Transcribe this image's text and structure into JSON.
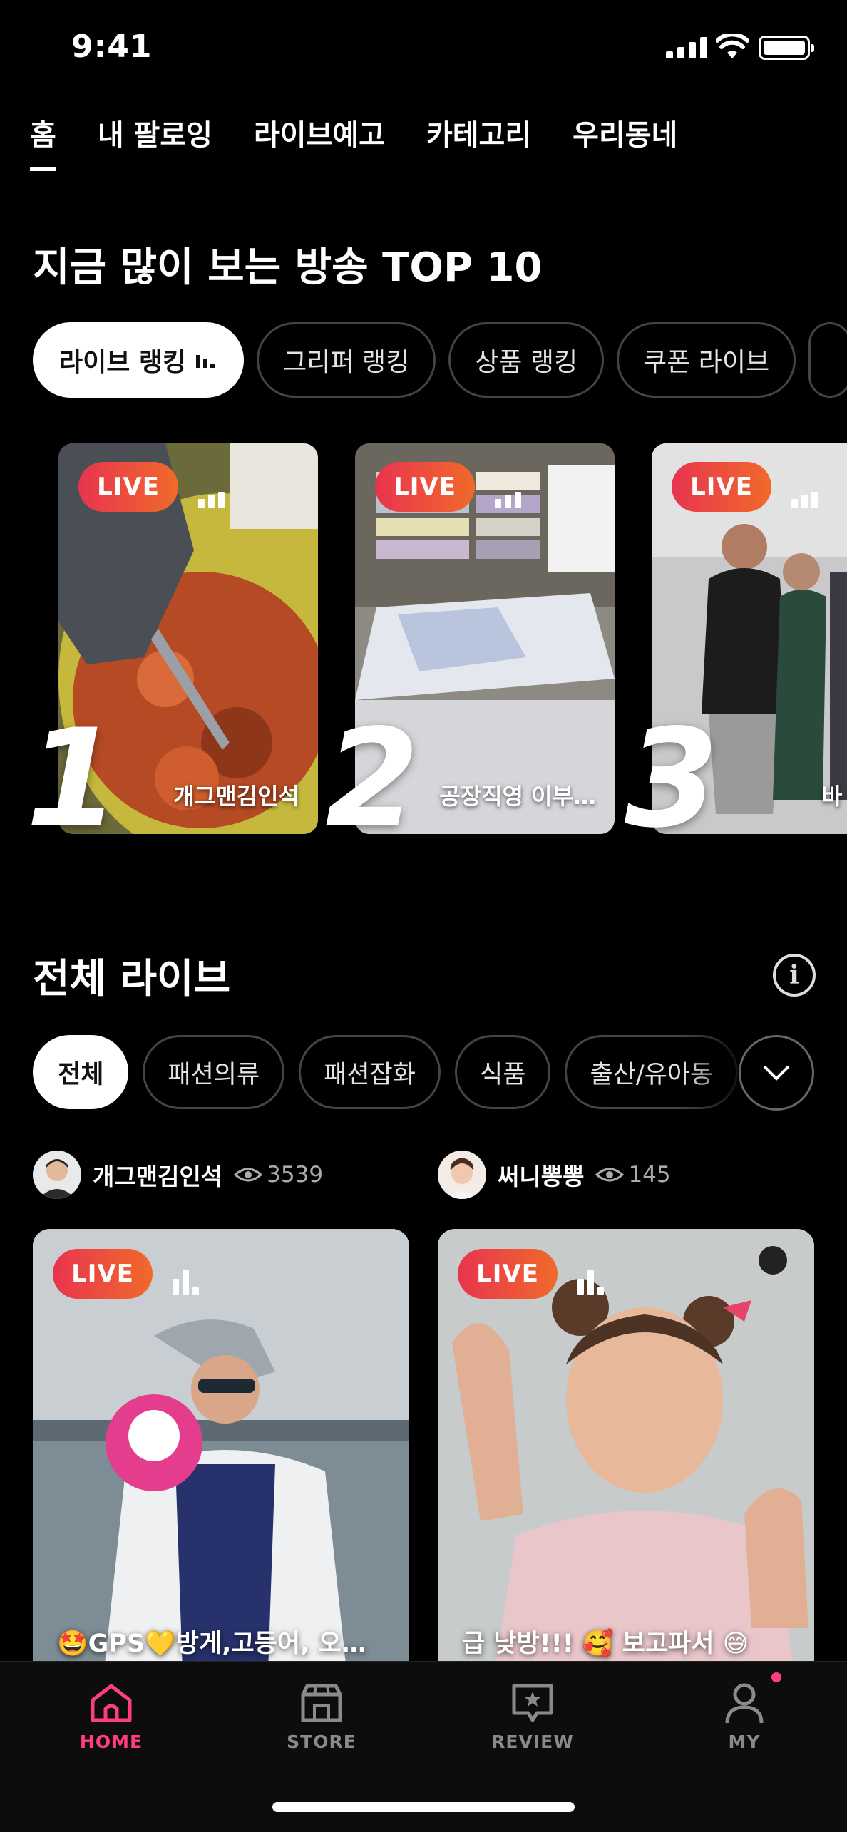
{
  "status": {
    "time": "9:41"
  },
  "top_tabs": [
    "홈",
    "내 팔로잉",
    "라이브예고",
    "카테고리",
    "우리동네"
  ],
  "ranking": {
    "title": "지금 많이 보는 방송 TOP 10",
    "chips": [
      "라이브 랭킹",
      "그리퍼 랭킹",
      "상품 랭킹",
      "쿠폰 라이브"
    ],
    "cards": [
      {
        "rank": "1",
        "badge": "LIVE",
        "name": "개그맨김인석"
      },
      {
        "rank": "2",
        "badge": "LIVE",
        "name": "공장직영 이부…"
      },
      {
        "rank": "3",
        "badge": "LIVE",
        "name": "바"
      }
    ]
  },
  "all_live": {
    "title": "전체 라이브",
    "info_icon": "info-icon",
    "categories": [
      "전체",
      "패션의류",
      "패션잡화",
      "식품",
      "출산/유아동"
    ],
    "streams": [
      {
        "host": "개그맨김인석",
        "viewers": "3539",
        "badge": "LIVE",
        "caption": "🤩GPS💛방게,고등어, 오…"
      },
      {
        "host": "써니뽕뽕",
        "viewers": "145",
        "badge": "LIVE",
        "caption": "급 낮방!!! 🥰 보고파서 😅"
      }
    ]
  },
  "bottom_nav": [
    {
      "label": "HOME",
      "icon": "home-icon",
      "active": true
    },
    {
      "label": "STORE",
      "icon": "store-icon",
      "active": false
    },
    {
      "label": "REVIEW",
      "icon": "review-icon",
      "active": false
    },
    {
      "label": "MY",
      "icon": "person-icon",
      "active": false
    }
  ],
  "colors": {
    "accent": "#ff3d7f",
    "live_start": "#e8344f",
    "live_end": "#f06a2a",
    "background": "#000000"
  }
}
